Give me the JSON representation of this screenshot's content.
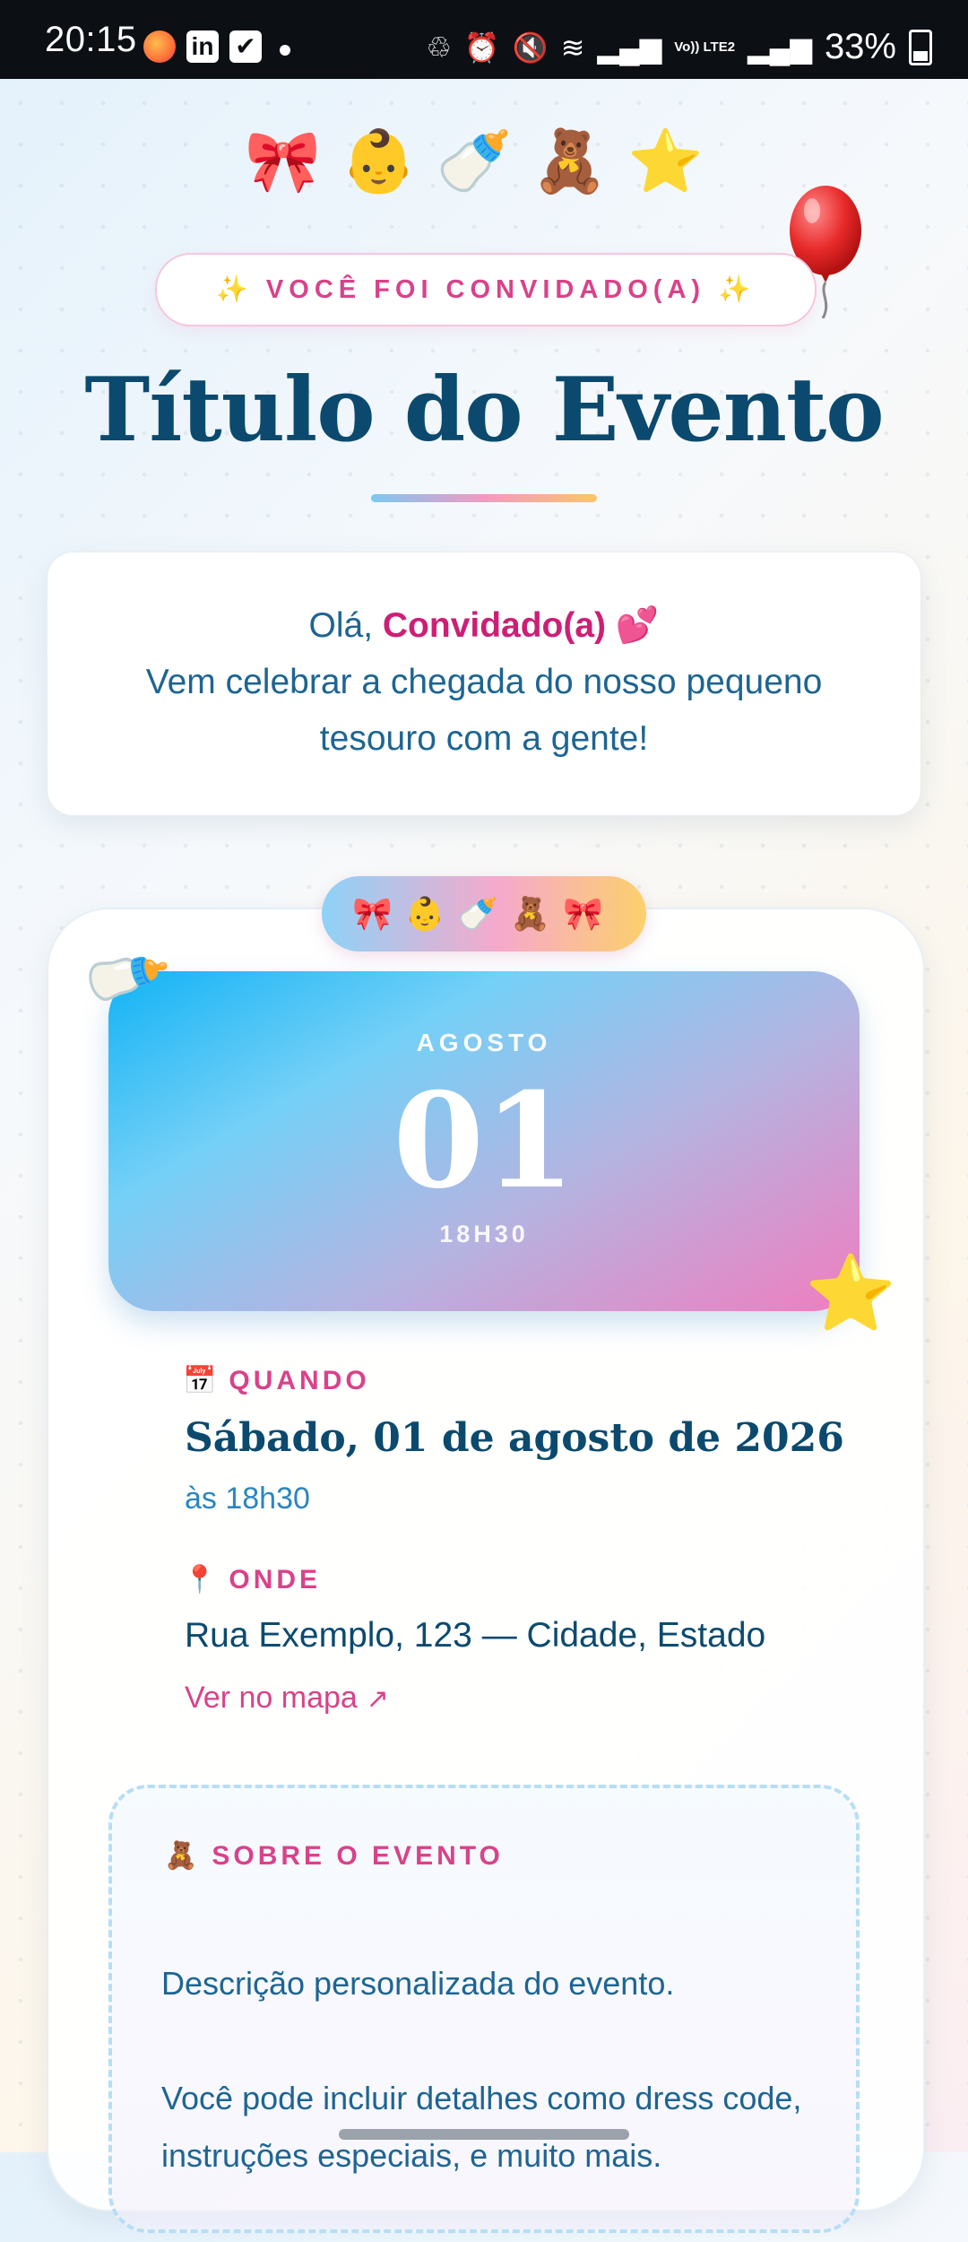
{
  "status_bar": {
    "time": "20:15",
    "battery": "33%",
    "network_label": "Vo)) LTE2"
  },
  "header": {
    "emojis": "🎀👶🍼🧸⭐",
    "invite_pill": "✨ VOCÊ FOI CONVIDADO(A) ✨",
    "title": "Título do Evento"
  },
  "greeting": {
    "hello": "Olá, ",
    "guest_name": "Convidado(a)",
    "heart": " 💕",
    "message": "Vem celebrar a chegada do nosso pequeno tesouro com a gente!"
  },
  "event_card": {
    "emoji_pill": "🎀👶🍼🧸🎀",
    "date": {
      "month": "AGOSTO",
      "day": "01",
      "time": "18H30"
    },
    "when": {
      "icon": "📅",
      "label": "QUANDO",
      "date": "Sábado, 01 de agosto de 2026",
      "time": "às 18h30"
    },
    "where": {
      "icon": "📍",
      "label": "ONDE",
      "address": "Rua Exemplo, 123 — Cidade, Estado",
      "map_link": "Ver no mapa",
      "map_arrow": "↗"
    },
    "about": {
      "icon": "🧸",
      "label": "SOBRE O EVENTO",
      "paragraphs": [
        "Descrição personalizada do evento.",
        "Você pode incluir detalhes como dress code, instruções especiais, e muito mais."
      ]
    }
  },
  "decorations": {
    "bottle": "🍼",
    "star": "⭐"
  },
  "colors": {
    "title": "#0b4a6e",
    "accent_pink": "#d9428a",
    "text_blue": "#1d6592"
  }
}
